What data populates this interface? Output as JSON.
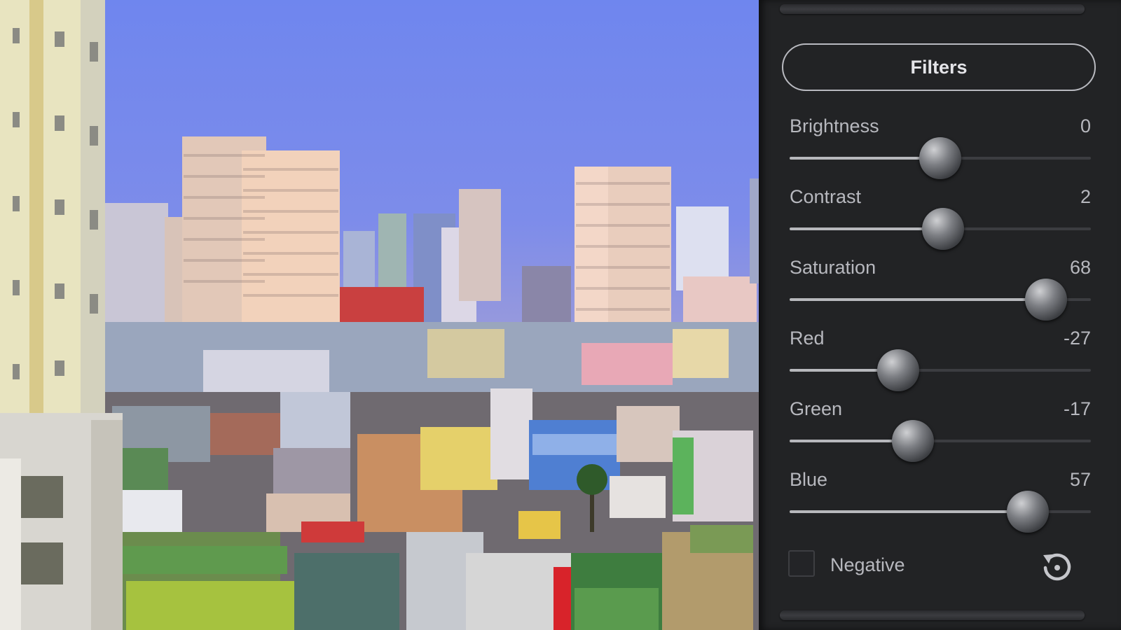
{
  "panel": {
    "filters_label": "Filters",
    "sliders": [
      {
        "id": "brightness",
        "label": "Brightness",
        "value": "0",
        "fraction": 0.5
      },
      {
        "id": "contrast",
        "label": "Contrast",
        "value": "2",
        "fraction": 0.51
      },
      {
        "id": "saturation",
        "label": "Saturation",
        "value": "68",
        "fraction": 0.85
      },
      {
        "id": "red",
        "label": "Red",
        "value": "-27",
        "fraction": 0.36
      },
      {
        "id": "green",
        "label": "Green",
        "value": "-17",
        "fraction": 0.41
      },
      {
        "id": "blue",
        "label": "Blue",
        "value": "57",
        "fraction": 0.79
      }
    ],
    "negative_label": "Negative",
    "negative_checked": false
  },
  "icons": {
    "reset": "reset-icon",
    "checkbox": "checkbox-icon"
  },
  "colors": {
    "panel_bg": "#222325",
    "text": "#b7b8be",
    "track_fill": "#b7b8bc",
    "track_empty": "#3c3d41"
  }
}
